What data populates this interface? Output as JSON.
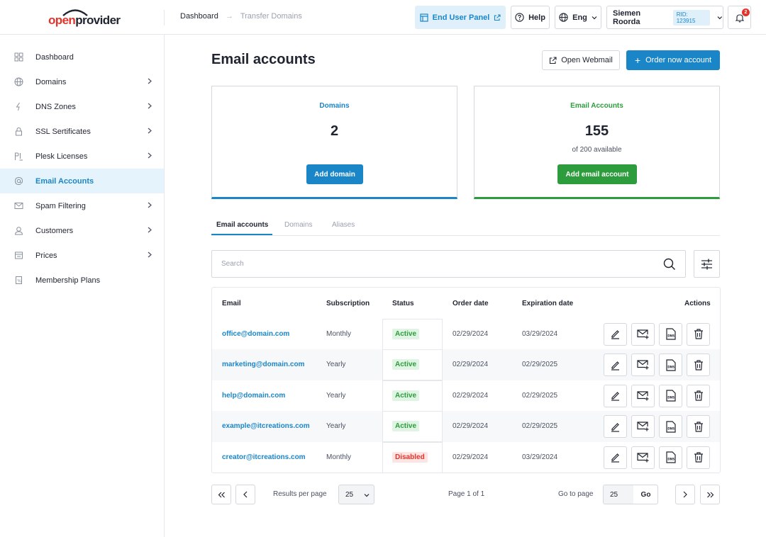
{
  "brand": {
    "logo_part1": "open",
    "logo_part2": "provider",
    "accent": "#1a86c8",
    "danger": "#e2342b",
    "success": "#2d9c3c"
  },
  "breadcrumb": {
    "items": [
      "Dashboard",
      "Transfer Domains"
    ],
    "separator": "→"
  },
  "header": {
    "end_user_panel": "End User Panel",
    "help": "Help",
    "language": "Eng",
    "user_name": "Siemen Roorda",
    "rid": "RID: 123915",
    "notifications_count": "2"
  },
  "sidebar": {
    "items": [
      {
        "label": "Dashboard",
        "icon": "grid-icon",
        "has_children": false
      },
      {
        "label": "Domains",
        "icon": "globe-icon",
        "has_children": true
      },
      {
        "label": "DNS Zones",
        "icon": "dns-icon",
        "has_children": true
      },
      {
        "label": "SSL Sertificates",
        "icon": "lock-icon",
        "has_children": true
      },
      {
        "label": "Plesk Licenses",
        "icon": "plesk-icon",
        "has_children": true
      },
      {
        "label": "Email Accounts",
        "icon": "at-icon",
        "has_children": false,
        "active": true
      },
      {
        "label": "Spam Filtering",
        "icon": "mail-filter-icon",
        "has_children": true
      },
      {
        "label": "Customers",
        "icon": "customers-icon",
        "has_children": true
      },
      {
        "label": "Prices",
        "icon": "price-icon",
        "has_children": true
      },
      {
        "label": "Membership Plans",
        "icon": "membership-icon",
        "has_children": false
      }
    ]
  },
  "main": {
    "title": "Email accounts",
    "open_webmail": "Open Webmail",
    "order_now": "Order now account",
    "cards": {
      "domains": {
        "title": "Domains",
        "value": "2",
        "button": "Add domain"
      },
      "email_accounts": {
        "title": "Email Accounts",
        "value": "155",
        "subtitle": "of 200 available",
        "button": "Add email account"
      }
    },
    "tabs": [
      "Email accounts",
      "Domains",
      "Aliases"
    ],
    "search_placeholder": "Search",
    "table": {
      "headers": {
        "email": "Email",
        "subscription": "Subscription",
        "status": "Status",
        "order_date": "Order date",
        "expiration_date": "Expiration date",
        "actions": "Actions"
      },
      "rows": [
        {
          "email": "office@domain.com",
          "subscription": "Monthly",
          "status": "Active",
          "order_date": "02/29/2024",
          "expiration_date": "03/29/2024"
        },
        {
          "email": "marketing@domain.com",
          "subscription": "Yearly",
          "status": "Active",
          "order_date": "02/29/2024",
          "expiration_date": "02/29/2025"
        },
        {
          "email": "help@domain.com",
          "subscription": "Yearly",
          "status": "Active",
          "order_date": "02/29/2024",
          "expiration_date": "02/29/2025"
        },
        {
          "email": "example@itcreations.com",
          "subscription": "Yearly",
          "status": "Active",
          "order_date": "02/29/2024",
          "expiration_date": "02/29/2025"
        },
        {
          "email": "creator@itcreations.com",
          "subscription": "Monthly",
          "status": "Disabled",
          "order_date": "02/29/2024",
          "expiration_date": "03/29/2024"
        }
      ]
    },
    "pagination": {
      "results_per_page_label": "Results per page",
      "results_per_page": "25",
      "page_info": "Page 1 of 1",
      "goto_label": "Go to page",
      "goto_value": "25",
      "go_button": "Go"
    }
  }
}
